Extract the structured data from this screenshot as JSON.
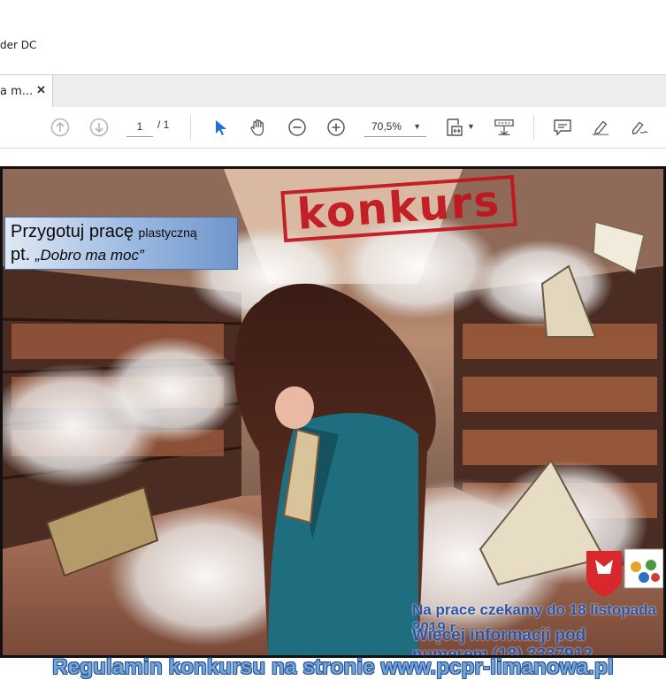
{
  "window": {
    "title": "der DC"
  },
  "tab": {
    "label": "a m...",
    "close_icon": "close-icon"
  },
  "toolbar": {
    "page_current": "1",
    "page_total": "/ 1",
    "zoom": "70,5%",
    "icons": [
      "prev-page-icon",
      "next-page-icon",
      "select-arrow-icon",
      "hand-icon",
      "zoom-out-icon",
      "zoom-in-icon",
      "fit-page-icon",
      "scroll-mode-icon",
      "comment-icon",
      "highlight-icon",
      "sign-icon"
    ]
  },
  "poster": {
    "intro_line1": "Przygotuj pracę",
    "intro_line1_small": "plastyczną",
    "intro_line2_prefix": "pt.",
    "intro_line2_quote": "„Dobro ma moc”",
    "stamp": "konkurs",
    "info_line1": "Na prace czekamy do 18 listopada 2019 r.",
    "info_line2": "Więcej informacji pod numerem (18) 3337912",
    "footer": "Regulamin konkursu na stronie www.pcpr-limanowa.pl"
  },
  "colors": {
    "stamp_red": "#c2121c",
    "info_blue": "#2b53a6",
    "footer_blue": "#6fa6de"
  }
}
